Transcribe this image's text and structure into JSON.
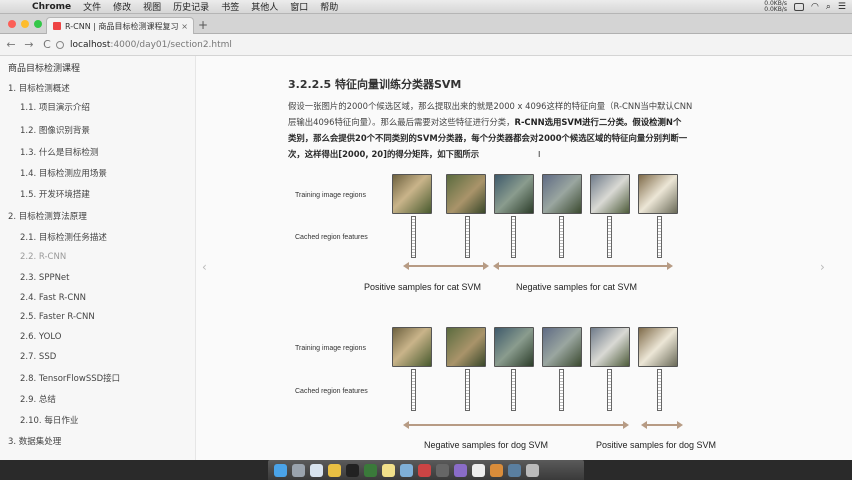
{
  "menubar": {
    "app_name": "Chrome",
    "items": [
      "文件",
      "修改",
      "视图",
      "历史记录",
      "书签",
      "其他人",
      "窗口",
      "帮助"
    ],
    "net_up": "0.0KB/s",
    "net_down": "0.0KB/s"
  },
  "tab": {
    "title": "R-CNN | 商品目标检测课程复习",
    "close": "×"
  },
  "new_tab": "+",
  "toolbar": {
    "back": "←",
    "forward": "→",
    "reload": "C",
    "url_host": "localhost",
    "url_path": ":4000/day01/section2.html"
  },
  "sidebar": {
    "brand": "商品目标检测课程",
    "chapters": [
      {
        "label": "1. 目标检测概述",
        "sections": [
          "1.1. 项目演示介绍",
          "1.2. 图像识别背景",
          "1.3. 什么是目标检测",
          "1.4. 目标检测应用场景",
          "1.5. 开发环境搭建"
        ]
      },
      {
        "label": "2. 目标检测算法原理",
        "sections": [
          "2.1. 目标检测任务描述",
          "2.2. R-CNN",
          "2.3. SPPNet",
          "2.4. Fast R-CNN",
          "2.5. Faster R-CNN",
          "2.6. YOLO",
          "2.7. SSD",
          "2.8. TensorFlowSSD接口",
          "2.9. 总结",
          "2.10. 每日作业"
        ]
      },
      {
        "label": "3. 数据集处理",
        "sections": []
      }
    ],
    "active": "2.2. R-CNN"
  },
  "nav_arrows": {
    "prev": "‹",
    "next": "›"
  },
  "content": {
    "heading": "3.2.2.5 特征向量训练分类器SVM",
    "para_line1": "假设一张图片的2000个候选区域，那么提取出来的就是2000 x 4096这样的特征向量（R-CNN当中默认CNN",
    "para_line2_a": "层输出4096特征向量）。那么最后需要对这些特征进行分类，",
    "para_line2_b": "R-CNN选用SVM进行二分类。假设检测N个",
    "para_line3": "类别，那么会提供20个不同类别的SVM分类器，每个分类器都会对2000个候选区域的特征向量分别判断一",
    "para_line4": "次，这样得出[2000, 20]的得分矩阵，如下图所示"
  },
  "figure": {
    "label_regions": "Training image regions",
    "label_features": "Cached region features",
    "cat_positive": "Positive samples for cat SVM",
    "cat_negative": "Negative samples for cat SVM",
    "dog_negative": "Negative samples for dog SVM",
    "dog_positive": "Positive samples for dog SVM"
  },
  "colors": {
    "range_arrow": "#b79b84",
    "tab_favicon": "#e44444"
  }
}
